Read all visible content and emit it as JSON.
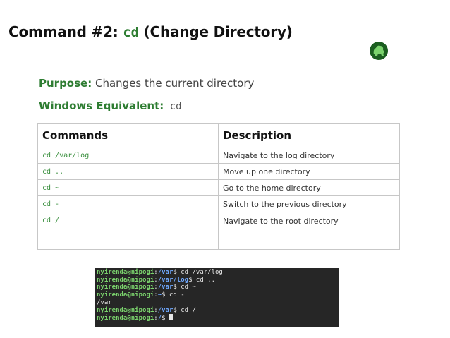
{
  "title": {
    "prefix": "Command #2: ",
    "code": "cd",
    "suffix": " (Change Directory)"
  },
  "logo_icon": "gorilla-silhouette",
  "purpose": {
    "label": "Purpose:",
    "text": " Changes the current directory"
  },
  "windows_equivalent": {
    "label": "Windows Equivalent:",
    "code": " cd"
  },
  "table": {
    "headers": [
      "Commands",
      "Description"
    ],
    "rows": [
      {
        "cmd": "cd /var/log",
        "desc": "Navigate to the log directory"
      },
      {
        "cmd": "cd ..",
        "desc": "Move up one directory"
      },
      {
        "cmd": "cd ~",
        "desc": "Go to the home directory"
      },
      {
        "cmd": "cd -",
        "desc": "Switch to the previous directory"
      },
      {
        "cmd": "cd /",
        "desc": "Navigate to the root directory"
      }
    ]
  },
  "terminal": {
    "user": "nyirenda@nipogi",
    "lines": [
      {
        "path": "/var",
        "cmd": " cd /var/log"
      },
      {
        "path": "/var/log",
        "cmd": " cd .."
      },
      {
        "path": "/var",
        "cmd": " cd ~"
      },
      {
        "path": "~",
        "cmd": " cd -"
      },
      {
        "output": "/var"
      },
      {
        "path": "/var",
        "cmd": " cd /"
      },
      {
        "path": "/",
        "cmd": " ",
        "cursor": true
      }
    ]
  },
  "colors": {
    "accent": "#2e7d32",
    "terminal_bg": "#262626",
    "terminal_user": "#7bd36d",
    "terminal_path": "#6fa8ff"
  }
}
